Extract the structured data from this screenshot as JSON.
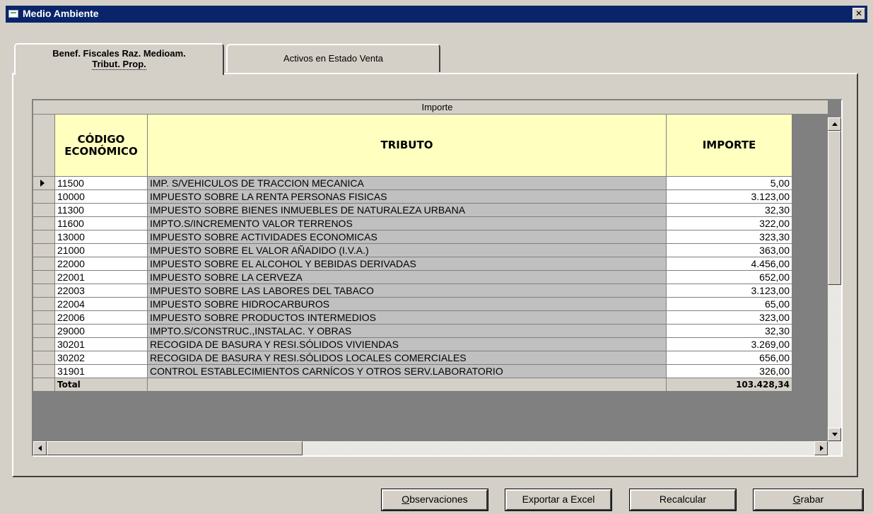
{
  "window": {
    "title": "Medio Ambiente",
    "close_glyph": "✕"
  },
  "tabs": [
    {
      "line1": "Benef. Fiscales Raz. Medioam.",
      "line2": "Tribut. Prop.",
      "active": true
    },
    {
      "label": "Activos en Estado Venta",
      "active": false
    }
  ],
  "grid": {
    "group_header": "Importe",
    "columns": {
      "codigo_line1": "CÓDIGO",
      "codigo_line2": "ECONÓMICO",
      "tributo": "TRIBUTO",
      "importe": "IMPORTE"
    },
    "rows": [
      {
        "code": "11500",
        "tributo": "IMP. S/VEHICULOS DE TRACCION MECANICA",
        "importe": "5,00"
      },
      {
        "code": "10000",
        "tributo": "IMPUESTO SOBRE LA RENTA PERSONAS FISICAS",
        "importe": "3.123,00"
      },
      {
        "code": "11300",
        "tributo": "IMPUESTO SOBRE BIENES INMUEBLES DE NATURALEZA URBANA",
        "importe": "32,30"
      },
      {
        "code": "11600",
        "tributo": "IMPTO.S/INCREMENTO VALOR TERRENOS",
        "importe": "322,00"
      },
      {
        "code": "13000",
        "tributo": "IMPUESTO SOBRE ACTIVIDADES ECONOMICAS",
        "importe": "323,30"
      },
      {
        "code": "21000",
        "tributo": "IMPUESTO SOBRE EL VALOR AÑADIDO  (I.V.A.)",
        "importe": "363,00"
      },
      {
        "code": "22000",
        "tributo": "IMPUESTO SOBRE EL ALCOHOL Y BEBIDAS DERIVADAS",
        "importe": "4.456,00"
      },
      {
        "code": "22001",
        "tributo": "IMPUESTO SOBRE LA CERVEZA",
        "importe": "652,00"
      },
      {
        "code": "22003",
        "tributo": "IMPUESTO SOBRE LAS LABORES DEL TABACO",
        "importe": "3.123,00"
      },
      {
        "code": "22004",
        "tributo": "IMPUESTO SOBRE HIDROCARBUROS",
        "importe": "65,00"
      },
      {
        "code": "22006",
        "tributo": "IMPUESTO SOBRE PRODUCTOS INTERMEDIOS",
        "importe": "323,00"
      },
      {
        "code": "29000",
        "tributo": "IMPTO.S/CONSTRUC.,INSTALAC. Y OBRAS",
        "importe": "32,30"
      },
      {
        "code": "30201",
        "tributo": "RECOGIDA DE BASURA Y RESI.SÓLIDOS VIVIENDAS",
        "importe": "3.269,00"
      },
      {
        "code": "30202",
        "tributo": "RECOGIDA DE BASURA Y RESI.SÓLIDOS LOCALES COMERCIALES",
        "importe": "656,00"
      },
      {
        "code": "31901",
        "tributo": "CONTROL ESTABLECIMIENTOS CARNÍCOS Y OTROS SERV.LABORATORIO",
        "importe": "326,00"
      }
    ],
    "total": {
      "label": "Total",
      "importe": "103.428,34"
    }
  },
  "buttons": {
    "observaciones": {
      "mnemonic": "O",
      "rest": "bservaciones"
    },
    "exportar": "Exportar a Excel",
    "recalcular": "Recalcular",
    "grabar": {
      "mnemonic": "G",
      "rest": "rabar"
    }
  },
  "colors": {
    "title_bar": "#0a246a",
    "header_bg": "#ffffc0",
    "face": "#d4d0c8",
    "tributo_cell": "#c0c0c0"
  }
}
